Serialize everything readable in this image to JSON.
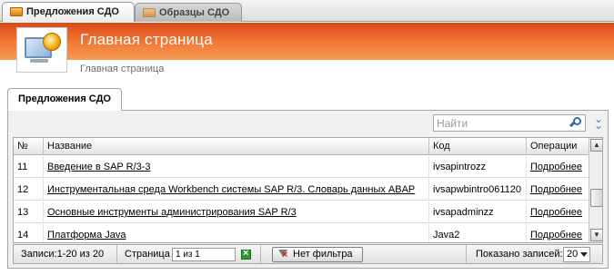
{
  "app_tabs": [
    {
      "label": "Предложения СДО",
      "active": true
    },
    {
      "label": "Образцы СДО",
      "active": false
    }
  ],
  "header": {
    "title": "Главная страница",
    "breadcrumb": "Главная страница"
  },
  "panel": {
    "tab_label": "Предложения СДО"
  },
  "search": {
    "placeholder": "Найти",
    "value": ""
  },
  "table": {
    "columns": [
      "№",
      "Название",
      "Код",
      "Операции"
    ],
    "rows": [
      {
        "num": "11",
        "name": "Введение в SAP R/3-3",
        "code": "ivsapintrozz",
        "action": "Подробнее"
      },
      {
        "num": "12",
        "name": "Инструментальная среда  Workbench системы SAP R/3. Словарь данных ABAP",
        "code": "ivsapwbintro061120",
        "action": "Подробнее"
      },
      {
        "num": "13",
        "name": "Основные инструменты администрирования SAP R/3",
        "code": "ivsapadminzz",
        "action": "Подробнее"
      },
      {
        "num": "14",
        "name": "Платформа Java",
        "code": "Java2",
        "action": "Подробнее"
      }
    ]
  },
  "footer": {
    "records": "Записи:1-20 из 20",
    "page_label": "Страница",
    "page_value": "1 из 1",
    "no_filter_label": "Нет фильтра",
    "shown_label": "Показано записей:",
    "page_size": "20"
  },
  "colors": {
    "header_orange": "#f27a36",
    "link_blue": "#3a67a8"
  }
}
